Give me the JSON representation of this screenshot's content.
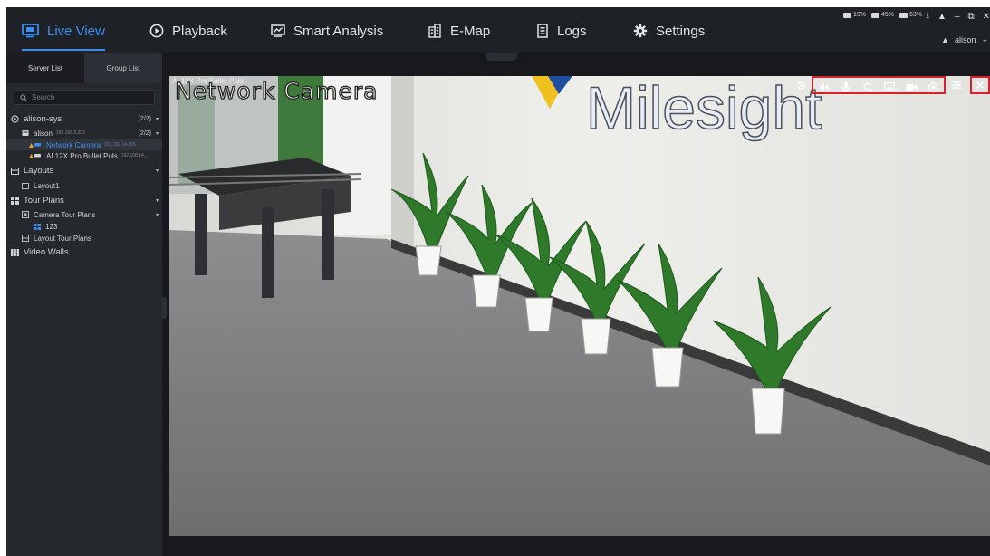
{
  "nav": {
    "tabs": [
      {
        "label": "Live View",
        "icon": "monitor-icon",
        "active": true
      },
      {
        "label": "Playback",
        "icon": "play-circle-icon"
      },
      {
        "label": "Smart Analysis",
        "icon": "analysis-icon"
      },
      {
        "label": "E-Map",
        "icon": "building-icon"
      },
      {
        "label": "Logs",
        "icon": "log-icon"
      },
      {
        "label": "Settings",
        "icon": "gear-icon"
      }
    ],
    "stats": [
      "19%",
      "45%",
      "63%"
    ],
    "user": "alison"
  },
  "sidebar": {
    "tabs": [
      "Server List",
      "Group List"
    ],
    "search_placeholder": "Search",
    "server": {
      "name": "alison-sys",
      "count": "(2/2)"
    },
    "device": {
      "name": "alison",
      "ip": "192.168.5.253",
      "count": "(2/2)"
    },
    "cameras": [
      {
        "name": "Network Camera",
        "ip": "192.168.14.165",
        "selected": true
      },
      {
        "name": "AI 12X Pro Bullet Puls",
        "ip": "192.168.14..."
      }
    ],
    "layouts": {
      "label": "Layouts",
      "items": [
        "Layout1"
      ]
    },
    "tour_plans": {
      "label": "Tour Plans",
      "camera_tour": "Camera Tour Plans",
      "camera_tour_items": [
        "123"
      ],
      "layout_tour": "Layout Tour Plans"
    },
    "video_walls": "Video Walls"
  },
  "viewer": {
    "camera_label": "AI 12X Pro Bullet Puls",
    "osd_text": "Network Camera",
    "wall_logo_text": "Milesight"
  },
  "colors": {
    "accent": "#3d8ef0",
    "highlight": "#d6232b"
  }
}
